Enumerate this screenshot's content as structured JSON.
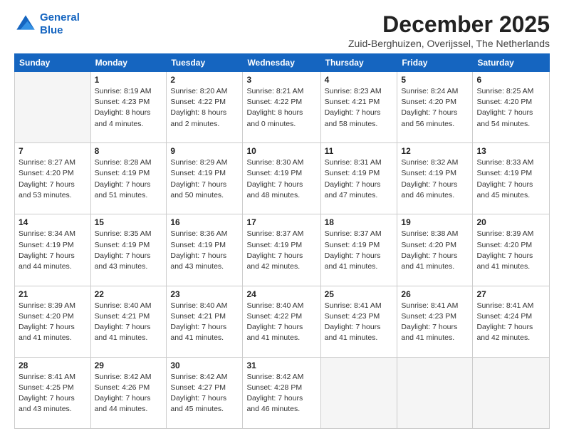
{
  "logo": {
    "line1": "General",
    "line2": "Blue"
  },
  "title": "December 2025",
  "location": "Zuid-Berghuizen, Overijssel, The Netherlands",
  "weekdays": [
    "Sunday",
    "Monday",
    "Tuesday",
    "Wednesday",
    "Thursday",
    "Friday",
    "Saturday"
  ],
  "weeks": [
    [
      {
        "day": "",
        "sunrise": "",
        "sunset": "",
        "daylight": ""
      },
      {
        "day": "1",
        "sunrise": "Sunrise: 8:19 AM",
        "sunset": "Sunset: 4:23 PM",
        "daylight": "Daylight: 8 hours and 4 minutes."
      },
      {
        "day": "2",
        "sunrise": "Sunrise: 8:20 AM",
        "sunset": "Sunset: 4:22 PM",
        "daylight": "Daylight: 8 hours and 2 minutes."
      },
      {
        "day": "3",
        "sunrise": "Sunrise: 8:21 AM",
        "sunset": "Sunset: 4:22 PM",
        "daylight": "Daylight: 8 hours and 0 minutes."
      },
      {
        "day": "4",
        "sunrise": "Sunrise: 8:23 AM",
        "sunset": "Sunset: 4:21 PM",
        "daylight": "Daylight: 7 hours and 58 minutes."
      },
      {
        "day": "5",
        "sunrise": "Sunrise: 8:24 AM",
        "sunset": "Sunset: 4:20 PM",
        "daylight": "Daylight: 7 hours and 56 minutes."
      },
      {
        "day": "6",
        "sunrise": "Sunrise: 8:25 AM",
        "sunset": "Sunset: 4:20 PM",
        "daylight": "Daylight: 7 hours and 54 minutes."
      }
    ],
    [
      {
        "day": "7",
        "sunrise": "Sunrise: 8:27 AM",
        "sunset": "Sunset: 4:20 PM",
        "daylight": "Daylight: 7 hours and 53 minutes."
      },
      {
        "day": "8",
        "sunrise": "Sunrise: 8:28 AM",
        "sunset": "Sunset: 4:19 PM",
        "daylight": "Daylight: 7 hours and 51 minutes."
      },
      {
        "day": "9",
        "sunrise": "Sunrise: 8:29 AM",
        "sunset": "Sunset: 4:19 PM",
        "daylight": "Daylight: 7 hours and 50 minutes."
      },
      {
        "day": "10",
        "sunrise": "Sunrise: 8:30 AM",
        "sunset": "Sunset: 4:19 PM",
        "daylight": "Daylight: 7 hours and 48 minutes."
      },
      {
        "day": "11",
        "sunrise": "Sunrise: 8:31 AM",
        "sunset": "Sunset: 4:19 PM",
        "daylight": "Daylight: 7 hours and 47 minutes."
      },
      {
        "day": "12",
        "sunrise": "Sunrise: 8:32 AM",
        "sunset": "Sunset: 4:19 PM",
        "daylight": "Daylight: 7 hours and 46 minutes."
      },
      {
        "day": "13",
        "sunrise": "Sunrise: 8:33 AM",
        "sunset": "Sunset: 4:19 PM",
        "daylight": "Daylight: 7 hours and 45 minutes."
      }
    ],
    [
      {
        "day": "14",
        "sunrise": "Sunrise: 8:34 AM",
        "sunset": "Sunset: 4:19 PM",
        "daylight": "Daylight: 7 hours and 44 minutes."
      },
      {
        "day": "15",
        "sunrise": "Sunrise: 8:35 AM",
        "sunset": "Sunset: 4:19 PM",
        "daylight": "Daylight: 7 hours and 43 minutes."
      },
      {
        "day": "16",
        "sunrise": "Sunrise: 8:36 AM",
        "sunset": "Sunset: 4:19 PM",
        "daylight": "Daylight: 7 hours and 43 minutes."
      },
      {
        "day": "17",
        "sunrise": "Sunrise: 8:37 AM",
        "sunset": "Sunset: 4:19 PM",
        "daylight": "Daylight: 7 hours and 42 minutes."
      },
      {
        "day": "18",
        "sunrise": "Sunrise: 8:37 AM",
        "sunset": "Sunset: 4:19 PM",
        "daylight": "Daylight: 7 hours and 41 minutes."
      },
      {
        "day": "19",
        "sunrise": "Sunrise: 8:38 AM",
        "sunset": "Sunset: 4:20 PM",
        "daylight": "Daylight: 7 hours and 41 minutes."
      },
      {
        "day": "20",
        "sunrise": "Sunrise: 8:39 AM",
        "sunset": "Sunset: 4:20 PM",
        "daylight": "Daylight: 7 hours and 41 minutes."
      }
    ],
    [
      {
        "day": "21",
        "sunrise": "Sunrise: 8:39 AM",
        "sunset": "Sunset: 4:20 PM",
        "daylight": "Daylight: 7 hours and 41 minutes."
      },
      {
        "day": "22",
        "sunrise": "Sunrise: 8:40 AM",
        "sunset": "Sunset: 4:21 PM",
        "daylight": "Daylight: 7 hours and 41 minutes."
      },
      {
        "day": "23",
        "sunrise": "Sunrise: 8:40 AM",
        "sunset": "Sunset: 4:21 PM",
        "daylight": "Daylight: 7 hours and 41 minutes."
      },
      {
        "day": "24",
        "sunrise": "Sunrise: 8:40 AM",
        "sunset": "Sunset: 4:22 PM",
        "daylight": "Daylight: 7 hours and 41 minutes."
      },
      {
        "day": "25",
        "sunrise": "Sunrise: 8:41 AM",
        "sunset": "Sunset: 4:23 PM",
        "daylight": "Daylight: 7 hours and 41 minutes."
      },
      {
        "day": "26",
        "sunrise": "Sunrise: 8:41 AM",
        "sunset": "Sunset: 4:23 PM",
        "daylight": "Daylight: 7 hours and 41 minutes."
      },
      {
        "day": "27",
        "sunrise": "Sunrise: 8:41 AM",
        "sunset": "Sunset: 4:24 PM",
        "daylight": "Daylight: 7 hours and 42 minutes."
      }
    ],
    [
      {
        "day": "28",
        "sunrise": "Sunrise: 8:41 AM",
        "sunset": "Sunset: 4:25 PM",
        "daylight": "Daylight: 7 hours and 43 minutes."
      },
      {
        "day": "29",
        "sunrise": "Sunrise: 8:42 AM",
        "sunset": "Sunset: 4:26 PM",
        "daylight": "Daylight: 7 hours and 44 minutes."
      },
      {
        "day": "30",
        "sunrise": "Sunrise: 8:42 AM",
        "sunset": "Sunset: 4:27 PM",
        "daylight": "Daylight: 7 hours and 45 minutes."
      },
      {
        "day": "31",
        "sunrise": "Sunrise: 8:42 AM",
        "sunset": "Sunset: 4:28 PM",
        "daylight": "Daylight: 7 hours and 46 minutes."
      },
      {
        "day": "",
        "sunrise": "",
        "sunset": "",
        "daylight": ""
      },
      {
        "day": "",
        "sunrise": "",
        "sunset": "",
        "daylight": ""
      },
      {
        "day": "",
        "sunrise": "",
        "sunset": "",
        "daylight": ""
      }
    ]
  ]
}
